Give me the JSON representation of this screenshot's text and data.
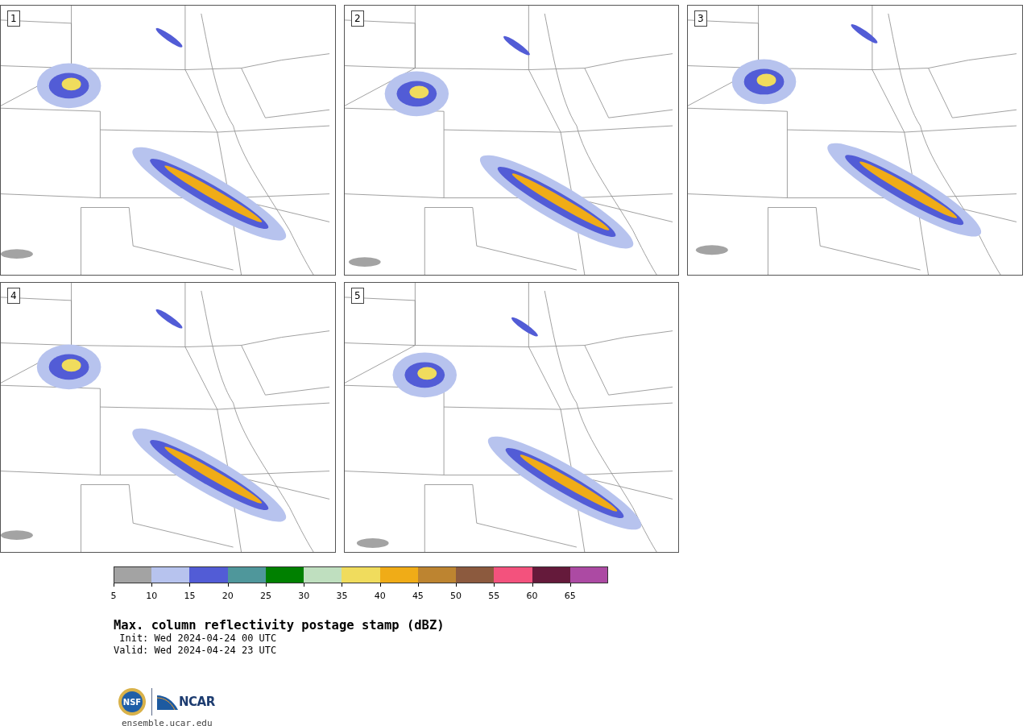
{
  "panels": [
    {
      "number": "1"
    },
    {
      "number": "2"
    },
    {
      "number": "3"
    },
    {
      "number": "4"
    },
    {
      "number": "5"
    }
  ],
  "colorbar": {
    "segments": [
      {
        "color": "#a3a3a3",
        "label": "5"
      },
      {
        "color": "#b7c3ee",
        "label": "10"
      },
      {
        "color": "#525cd6",
        "label": "15"
      },
      {
        "color": "#4f979b",
        "label": "20"
      },
      {
        "color": "#008000",
        "label": "25"
      },
      {
        "color": "#bfdfbf",
        "label": "30"
      },
      {
        "color": "#f0dc5d",
        "label": "35"
      },
      {
        "color": "#f0ac17",
        "label": "40"
      },
      {
        "color": "#bd8430",
        "label": "45"
      },
      {
        "color": "#8c5a3e",
        "label": "50"
      },
      {
        "color": "#f3527d",
        "label": "55"
      },
      {
        "color": "#651a3b",
        "label": "60"
      },
      {
        "color": "#ac4aa3",
        "label": "65"
      }
    ]
  },
  "title": "Max. column reflectivity postage stamp (dBZ)",
  "init": " Init: Wed 2024-04-24 00 UTC",
  "valid": "Valid: Wed 2024-04-24 23 UTC",
  "logos": {
    "nsf": "NSF",
    "ncar": "NCAR"
  },
  "url": "ensemble.ucar.edu"
}
